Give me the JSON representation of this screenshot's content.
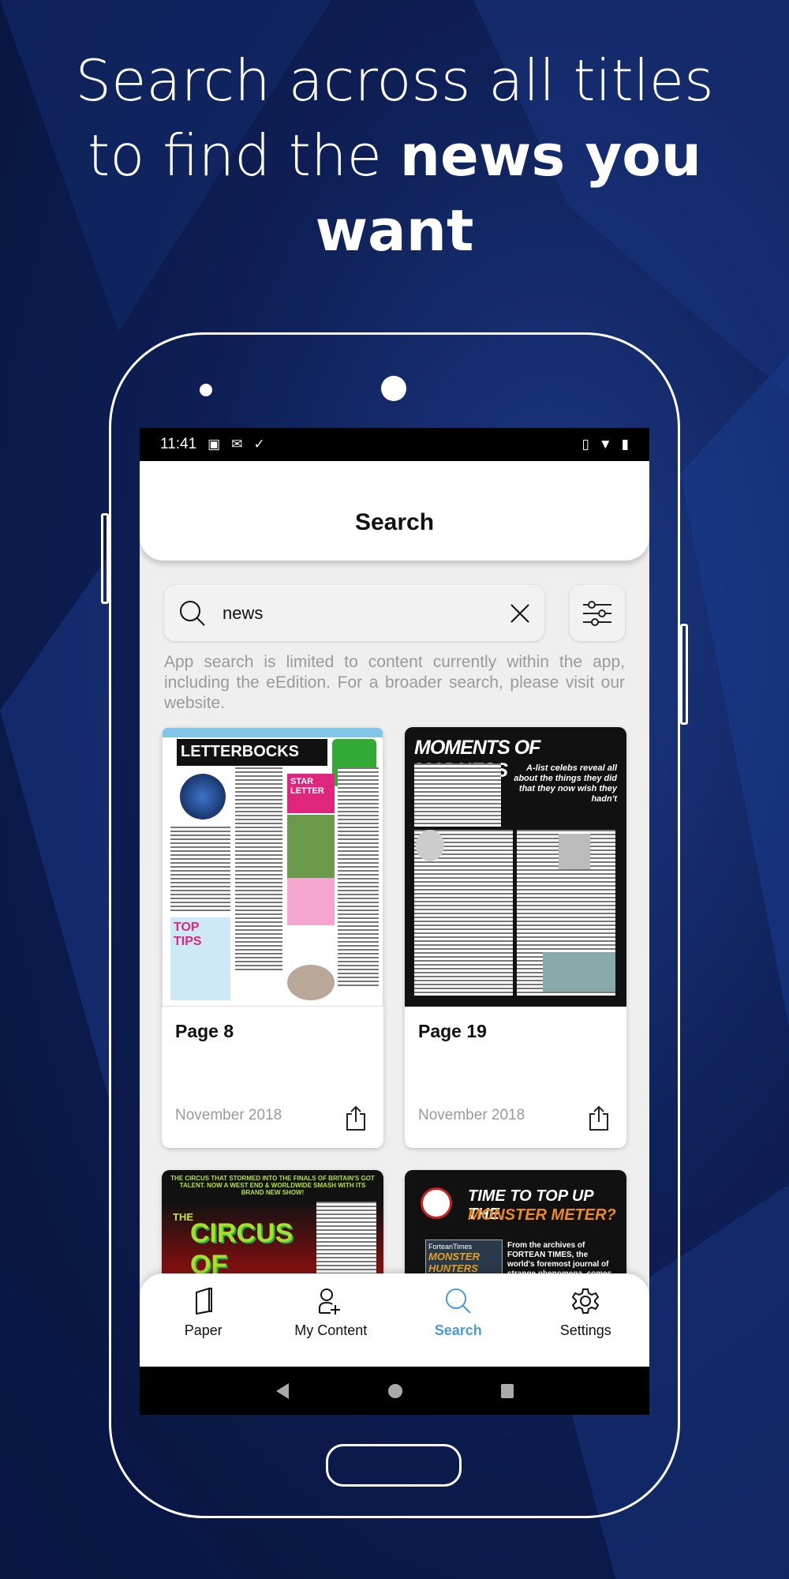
{
  "headline": {
    "line1": "Search across all titles",
    "line2_pre": "to find the ",
    "line2_bold": "news you",
    "line3_bold": "want"
  },
  "status_bar": {
    "time": "11:41",
    "icons": [
      "image-icon",
      "gmail-icon",
      "download-done-icon"
    ],
    "right_icons": [
      "vibrate-icon",
      "wifi-icon",
      "battery-icon"
    ]
  },
  "header": {
    "title": "Search"
  },
  "search": {
    "value": "news",
    "icon": "search-icon",
    "clear_icon": "close-icon",
    "filter_icon": "sliders-icon"
  },
  "info_text": "App search is limited to content currently within the app, including the eEdition. For a broader search, please visit our website.",
  "results": [
    {
      "page": "Page 8",
      "date": "November 2018",
      "thumb_title": "LETTERBOCKS",
      "thumb_sub": "STAR LETTER",
      "thumb_extra": "TOP TIPS"
    },
    {
      "page": "Page 19",
      "date": "November 2018",
      "thumb_title": "MOMENTS OF MADNESS",
      "thumb_sub": "A-list celebs reveal all about the things they did that they now wish they hadn't"
    },
    {
      "thumb_top": "THE CIRCUS THAT STORMED INTO THE FINALS OF BRITAIN'S GOT TALENT. NOW A WEST END & WORLDWIDE SMASH WITH ITS BRAND NEW SHOW!",
      "thumb_title": "CIRCUS OF HORRORS",
      "thumb_pre": "THE"
    },
    {
      "thumb_title1": "TIME TO TOP UP THE",
      "thumb_title2": "MONSTER METER?",
      "thumb_brand": "ForteanTimes",
      "thumb_book": "MONSTER HUNTERS",
      "thumb_text": "From the archives of FORTEAN TIMES, the world's foremost journal of strange phenomena, comes a new collection"
    }
  ],
  "bottom_nav": [
    {
      "label": "Paper",
      "icon": "book-icon",
      "active": false
    },
    {
      "label": "My Content",
      "icon": "add-user-icon",
      "active": false
    },
    {
      "label": "Search",
      "icon": "search-icon",
      "active": true
    },
    {
      "label": "Settings",
      "icon": "gear-icon",
      "active": false
    }
  ],
  "colors": {
    "accent": "#4a9ade",
    "background": "#0e1f56"
  }
}
